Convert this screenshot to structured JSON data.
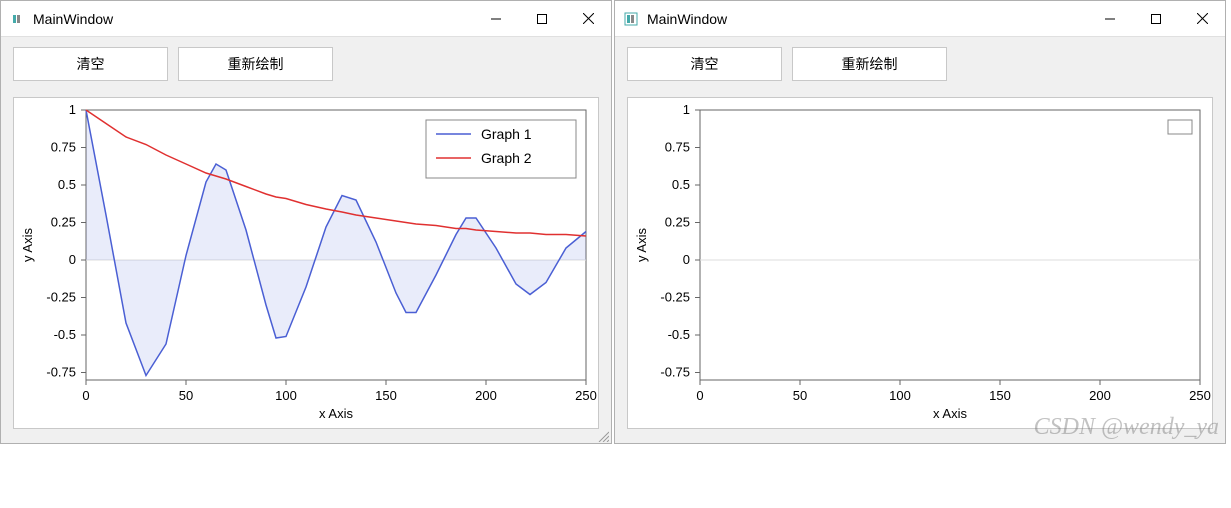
{
  "windows": [
    {
      "title": "MainWindow",
      "toolbar": {
        "clear_label": "清空",
        "redraw_label": "重新绘制"
      },
      "has_data": true
    },
    {
      "title": "MainWindow",
      "toolbar": {
        "clear_label": "清空",
        "redraw_label": "重新绘制"
      },
      "has_data": false
    }
  ],
  "plot": {
    "xlabel": "x Axis",
    "ylabel": "y Axis",
    "x_ticks": [
      0,
      50,
      100,
      150,
      200,
      250
    ],
    "y_ticks": [
      -0.75,
      -0.5,
      -0.25,
      0,
      0.25,
      0.5,
      0.75,
      1
    ],
    "xlim": [
      0,
      250
    ],
    "ylim": [
      -0.8,
      1.0
    ],
    "legend": [
      "Graph 1",
      "Graph 2"
    ]
  },
  "watermark": "CSDN @wendy_ya",
  "chart_data": [
    {
      "type": "line",
      "title": "",
      "xlabel": "x Axis",
      "ylabel": "y Axis",
      "xlim": [
        0,
        250
      ],
      "ylim": [
        -0.8,
        1.0
      ],
      "legend_position": "top-right",
      "x": [
        0,
        10,
        20,
        30,
        40,
        50,
        60,
        65,
        70,
        80,
        90,
        95,
        100,
        110,
        120,
        128,
        135,
        145,
        155,
        160,
        165,
        175,
        185,
        190,
        195,
        205,
        215,
        222,
        230,
        240,
        250
      ],
      "series": [
        {
          "name": "Graph 1",
          "fill_to_zero": true,
          "color": "#4a5fd4",
          "values": [
            1.0,
            0.3,
            -0.42,
            -0.77,
            -0.56,
            0.03,
            0.52,
            0.64,
            0.6,
            0.2,
            -0.3,
            -0.52,
            -0.51,
            -0.18,
            0.22,
            0.43,
            0.4,
            0.12,
            -0.22,
            -0.35,
            -0.35,
            -0.1,
            0.17,
            0.28,
            0.28,
            0.08,
            -0.16,
            -0.23,
            -0.15,
            0.08,
            0.19
          ]
        },
        {
          "name": "Graph 2",
          "fill_to_zero": false,
          "color": "#e03030",
          "values": [
            1.0,
            0.91,
            0.82,
            0.77,
            0.7,
            0.64,
            0.58,
            0.56,
            0.54,
            0.49,
            0.44,
            0.42,
            0.41,
            0.37,
            0.34,
            0.32,
            0.3,
            0.28,
            0.26,
            0.25,
            0.24,
            0.23,
            0.21,
            0.21,
            0.2,
            0.19,
            0.18,
            0.18,
            0.17,
            0.17,
            0.16
          ]
        }
      ]
    },
    {
      "type": "line",
      "title": "",
      "xlabel": "x Axis",
      "ylabel": "y Axis",
      "xlim": [
        0,
        250
      ],
      "ylim": [
        -0.8,
        1.0
      ],
      "legend_position": "top-right",
      "x": [],
      "series": []
    }
  ]
}
